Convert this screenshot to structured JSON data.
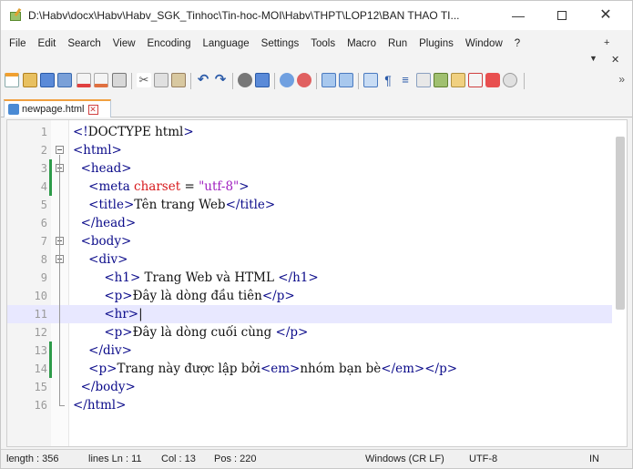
{
  "window": {
    "title": "D:\\Habv\\docx\\Habv\\Habv_SGK_Tinhoc\\Tin-hoc-MOI\\Habv\\THPT\\LOP12\\BAN THAO TI...",
    "minimize": "—",
    "close": "✕"
  },
  "menu": {
    "items": [
      "File",
      "Edit",
      "Search",
      "View",
      "Encoding",
      "Language",
      "Settings",
      "Tools",
      "Macro",
      "Run",
      "Plugins",
      "Window",
      "?"
    ],
    "plus": "+",
    "arrow": "▼",
    "close_doc": "✕"
  },
  "toolbar": {
    "overflow": "»",
    "icons": [
      "new-file-icon",
      "open-file-icon",
      "save-icon",
      "save-all-icon",
      "close-icon",
      "close-all-icon",
      "print-icon",
      "cut-icon",
      "copy-icon",
      "paste-icon",
      "undo-icon",
      "redo-icon",
      "find-icon",
      "replace-icon",
      "zoom-in-icon",
      "zoom-out-icon",
      "sync-v-icon",
      "sync-h-icon",
      "word-wrap-icon",
      "all-chars-icon",
      "indent-guide-icon",
      "doc-map-icon",
      "function-list-icon",
      "folder-workspace-icon",
      "monitor-icon",
      "record-icon",
      "play-icon"
    ]
  },
  "tab": {
    "label": "newpage.html",
    "close": "✕"
  },
  "editor": {
    "lines": [
      {
        "n": "1",
        "tokens": [
          [
            "tag",
            "<!"
          ],
          [
            "txt",
            "DOCTYPE html"
          ],
          [
            "tag",
            ">"
          ]
        ]
      },
      {
        "n": "2",
        "tokens": [
          [
            "tag",
            "<html>"
          ]
        ]
      },
      {
        "n": "3",
        "tokens": [
          [
            "txt",
            "  "
          ],
          [
            "tag",
            "<head>"
          ]
        ]
      },
      {
        "n": "4",
        "tokens": [
          [
            "txt",
            "    "
          ],
          [
            "tag",
            "<meta "
          ],
          [
            "attr",
            "charset"
          ],
          [
            "txt",
            " = "
          ],
          [
            "val",
            "\"utf-8\""
          ],
          [
            "tag",
            ">"
          ]
        ]
      },
      {
        "n": "5",
        "tokens": [
          [
            "txt",
            "    "
          ],
          [
            "tag",
            "<title>"
          ],
          [
            "txt",
            "Tên trang Web"
          ],
          [
            "tag",
            "</title>"
          ]
        ]
      },
      {
        "n": "6",
        "tokens": [
          [
            "txt",
            "  "
          ],
          [
            "tag",
            "</head>"
          ]
        ]
      },
      {
        "n": "7",
        "tokens": [
          [
            "txt",
            "  "
          ],
          [
            "tag",
            "<body>"
          ]
        ]
      },
      {
        "n": "8",
        "tokens": [
          [
            "txt",
            "    "
          ],
          [
            "tag",
            "<div>"
          ]
        ]
      },
      {
        "n": "9",
        "tokens": [
          [
            "txt",
            "        "
          ],
          [
            "tag",
            "<h1>"
          ],
          [
            "txt",
            " Trang Web và HTML "
          ],
          [
            "tag",
            "</h1>"
          ]
        ]
      },
      {
        "n": "10",
        "tokens": [
          [
            "txt",
            "        "
          ],
          [
            "tag",
            "<p>"
          ],
          [
            "txt",
            "Đây là dòng đầu tiên"
          ],
          [
            "tag",
            "</p>"
          ]
        ]
      },
      {
        "n": "11",
        "tokens": [
          [
            "txt",
            "        "
          ],
          [
            "tag",
            "<hr>"
          ],
          [
            "txt",
            "|"
          ]
        ]
      },
      {
        "n": "12",
        "tokens": [
          [
            "txt",
            "        "
          ],
          [
            "tag",
            "<p>"
          ],
          [
            "txt",
            "Đây là dòng cuối cùng "
          ],
          [
            "tag",
            "</p>"
          ]
        ]
      },
      {
        "n": "13",
        "tokens": [
          [
            "txt",
            "    "
          ],
          [
            "tag",
            "</div>"
          ]
        ]
      },
      {
        "n": "14",
        "tokens": [
          [
            "txt",
            "    "
          ],
          [
            "tag",
            "<p>"
          ],
          [
            "txt",
            "Trang này được lập bởi"
          ],
          [
            "tag",
            "<em>"
          ],
          [
            "txt",
            "nhóm bạn bè"
          ],
          [
            "tag",
            "</em></p>"
          ]
        ]
      },
      {
        "n": "15",
        "tokens": [
          [
            "txt",
            "  "
          ],
          [
            "tag",
            "</body>"
          ]
        ]
      },
      {
        "n": "16",
        "tokens": [
          [
            "tag",
            "</html>"
          ]
        ]
      }
    ],
    "current_line": "11"
  },
  "status": {
    "length": "length : 356",
    "lines": "lines Ln : 11",
    "col": "Col : 13",
    "pos": "Pos : 220",
    "eol": "Windows (CR LF)",
    "encoding": "UTF-8",
    "mode": "IN"
  },
  "colors": {
    "tag": "#0b0b8a",
    "attr": "#d7191c",
    "val": "#a020c0",
    "current_line_bg": "#e8e8ff",
    "change_bar": "#2e9b4a"
  }
}
